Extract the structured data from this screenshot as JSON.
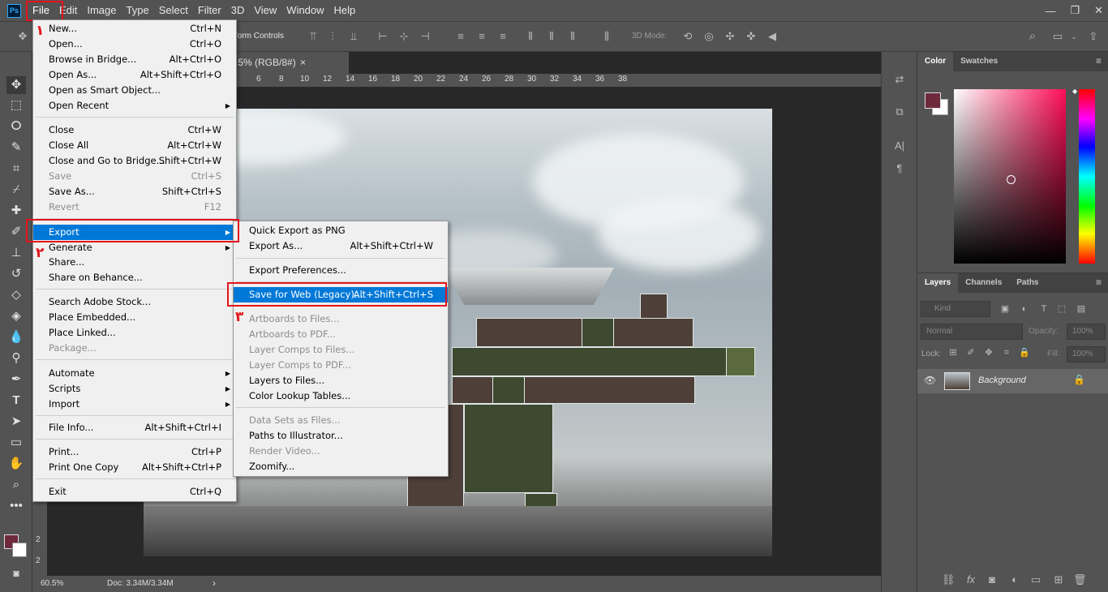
{
  "app_logo": "Ps",
  "menubar": [
    "File",
    "Edit",
    "Image",
    "Type",
    "Select",
    "Filter",
    "3D",
    "View",
    "Window",
    "Help"
  ],
  "options": {
    "transform_controls": "form Controls",
    "mode3d": "3D Mode:"
  },
  "doc_tab": {
    "title": ".5% (RGB/8#)",
    "close": "×"
  },
  "ruler_marks": [
    "6",
    "8",
    "10",
    "12",
    "14",
    "16",
    "18",
    "20",
    "22",
    "24",
    "26",
    "28",
    "30",
    "32",
    "34",
    "36",
    "38"
  ],
  "ruler_left_marks": [
    "2",
    "2"
  ],
  "status": {
    "zoom": "60.5%",
    "doc": "Doc: 3.34M/3.34M",
    "arrow": "›"
  },
  "color_panel": {
    "tabs": [
      "Color",
      "Swatches"
    ],
    "foreground": "#6e2a3c",
    "background": "#ffffff"
  },
  "layers_panel": {
    "tabs": [
      "Layers",
      "Channels",
      "Paths"
    ],
    "kind": "Kind",
    "blend": "Normal",
    "opacity_label": "Opacity:",
    "opacity": "100%",
    "lock_label": "Lock:",
    "fill_label": "Fill:",
    "fill": "100%",
    "layer_name": "Background"
  },
  "file_menu": [
    {
      "label": "New...",
      "shortcut": "Ctrl+N"
    },
    {
      "label": "Open...",
      "shortcut": "Ctrl+O"
    },
    {
      "label": "Browse in Bridge...",
      "shortcut": "Alt+Ctrl+O"
    },
    {
      "label": "Open As...",
      "shortcut": "Alt+Shift+Ctrl+O"
    },
    {
      "label": "Open as Smart Object...",
      "shortcut": ""
    },
    {
      "label": "Open Recent",
      "shortcut": ""
    },
    {
      "label": "Close",
      "shortcut": "Ctrl+W"
    },
    {
      "label": "Close All",
      "shortcut": "Alt+Ctrl+W"
    },
    {
      "label": "Close and Go to Bridge...",
      "shortcut": "Shift+Ctrl+W"
    },
    {
      "label": "Save",
      "shortcut": "Ctrl+S"
    },
    {
      "label": "Save As...",
      "shortcut": "Shift+Ctrl+S"
    },
    {
      "label": "Revert",
      "shortcut": "F12"
    },
    {
      "label": "Export",
      "shortcut": ""
    },
    {
      "label": "Generate",
      "shortcut": ""
    },
    {
      "label": "Share...",
      "shortcut": ""
    },
    {
      "label": "Share on Behance...",
      "shortcut": ""
    },
    {
      "label": "Search Adobe Stock...",
      "shortcut": ""
    },
    {
      "label": "Place Embedded...",
      "shortcut": ""
    },
    {
      "label": "Place Linked...",
      "shortcut": ""
    },
    {
      "label": "Package...",
      "shortcut": ""
    },
    {
      "label": "Automate",
      "shortcut": ""
    },
    {
      "label": "Scripts",
      "shortcut": ""
    },
    {
      "label": "Import",
      "shortcut": ""
    },
    {
      "label": "File Info...",
      "shortcut": "Alt+Shift+Ctrl+I"
    },
    {
      "label": "Print...",
      "shortcut": "Ctrl+P"
    },
    {
      "label": "Print One Copy",
      "shortcut": "Alt+Shift+Ctrl+P"
    },
    {
      "label": "Exit",
      "shortcut": "Ctrl+Q"
    }
  ],
  "export_menu": [
    {
      "label": "Quick Export as PNG",
      "shortcut": ""
    },
    {
      "label": "Export As...",
      "shortcut": "Alt+Shift+Ctrl+W"
    },
    {
      "label": "Export Preferences...",
      "shortcut": ""
    },
    {
      "label": "Save for Web (Legacy)...",
      "shortcut": "Alt+Shift+Ctrl+S"
    },
    {
      "label": "Artboards to Files...",
      "shortcut": ""
    },
    {
      "label": "Artboards to PDF...",
      "shortcut": ""
    },
    {
      "label": "Layer Comps to Files...",
      "shortcut": ""
    },
    {
      "label": "Layer Comps to PDF...",
      "shortcut": ""
    },
    {
      "label": "Layers to Files...",
      "shortcut": ""
    },
    {
      "label": "Color Lookup Tables...",
      "shortcut": ""
    },
    {
      "label": "Data Sets as Files...",
      "shortcut": ""
    },
    {
      "label": "Paths to Illustrator...",
      "shortcut": ""
    },
    {
      "label": "Render Video...",
      "shortcut": ""
    },
    {
      "label": "Zoomify...",
      "shortcut": ""
    }
  ],
  "annotations": [
    "۱",
    "۲",
    "۳"
  ],
  "highlight_color": "#e3141b"
}
